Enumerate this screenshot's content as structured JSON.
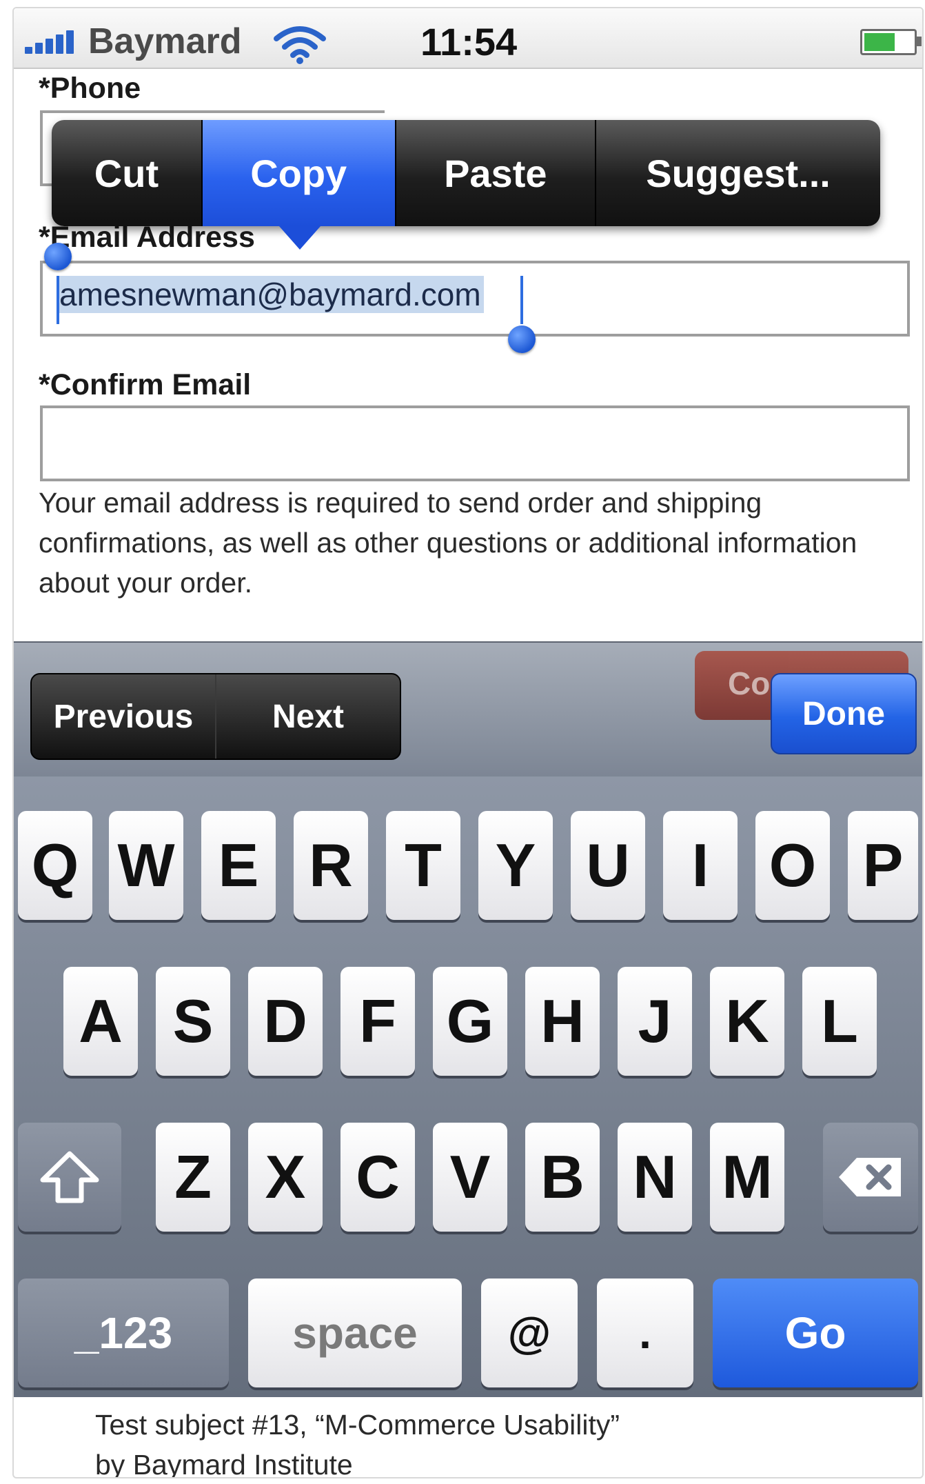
{
  "status": {
    "carrier": "Baymard",
    "time": "11:54"
  },
  "form": {
    "phone_label": "*Phone",
    "email_label": "*Email Address",
    "email_value": "amesnewman@baymard.com",
    "confirm_label": "*Confirm Email",
    "confirm_value": "",
    "help_text": "Your email address is required to send order and shipping confirmations, as well as other questions or additional information about your order."
  },
  "edit_menu": {
    "items": [
      "Cut",
      "Copy",
      "Paste",
      "Suggest..."
    ],
    "active": "Copy"
  },
  "accessory": {
    "previous": "Previous",
    "next": "Next",
    "obscured_button": "Co",
    "done": "Done"
  },
  "keyboard": {
    "row1": [
      "Q",
      "W",
      "E",
      "R",
      "T",
      "Y",
      "U",
      "I",
      "O",
      "P"
    ],
    "row2": [
      "A",
      "S",
      "D",
      "F",
      "G",
      "H",
      "J",
      "K",
      "L"
    ],
    "row3": [
      "Z",
      "X",
      "C",
      "V",
      "B",
      "N",
      "M"
    ],
    "numbers_key": "_123",
    "space_key": "space",
    "at_key": "@",
    "dot_key": ".",
    "go_key": "Go",
    "shift_icon": "shift-icon",
    "delete_icon": "delete-icon"
  },
  "caption": {
    "line1": "Test subject #13, “M-Commerce Usability”",
    "line2": "by Baymard Institute"
  },
  "colors": {
    "accent_blue": "#2a62ee",
    "selection": "#c6d8ee",
    "battery": "#3cb548"
  }
}
